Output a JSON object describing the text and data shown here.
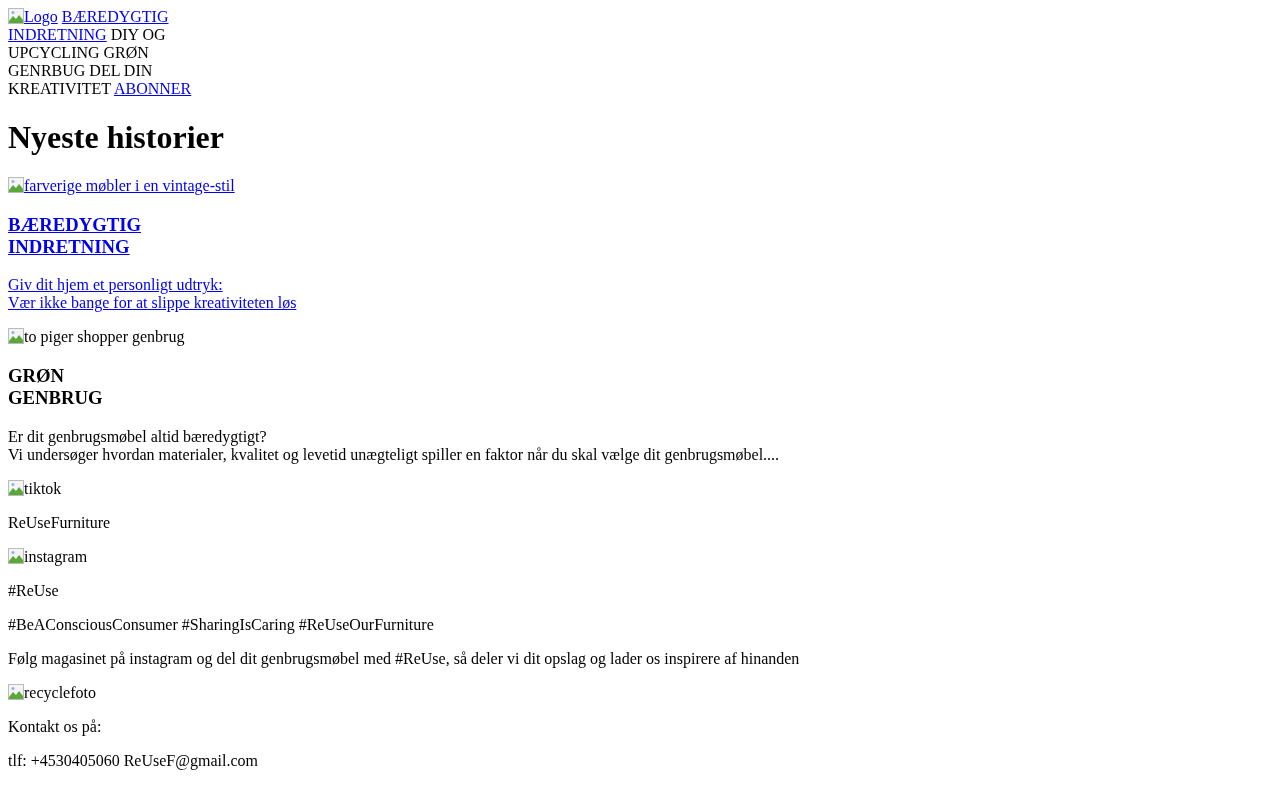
{
  "header": {
    "logo": {
      "alt": "Logo"
    },
    "items": [
      {
        "kind": "link",
        "lines": [
          "BÆREDYGTIG",
          "INDRETNING"
        ]
      },
      {
        "kind": "text",
        "lines": [
          "DIY OG",
          "UPCYCLING"
        ]
      },
      {
        "kind": "text",
        "lines": [
          "GRØN",
          "GENRBUG"
        ]
      },
      {
        "kind": "text",
        "lines": [
          "DEL DIN",
          "KREATIVITET"
        ]
      },
      {
        "kind": "link",
        "lines": [
          "ABONNER"
        ]
      }
    ]
  },
  "heading": "Nyeste historier",
  "articles": [
    {
      "image_alt": "farverige møbler i en vintage-stil",
      "linked": true,
      "title_lines": [
        "BÆREDYGTIG",
        "INDRETNING"
      ],
      "text_lines": [
        "Giv dit hjem et personligt udtryk:",
        "Vær ikke bange for at slippe kreativiteten løs"
      ]
    },
    {
      "image_alt": "to piger shopper genbrug",
      "linked": false,
      "title_lines": [
        "GRØN",
        "GENBRUG"
      ],
      "text_lines": [
        "Er dit genbrugsmøbel altid bæredygtigt?",
        "Vi undersøger hvordan materialer, kvalitet og levetid unægteligt spiller en faktor når du skal vælge dit genbrugsmøbel...."
      ]
    }
  ],
  "footer": [
    {
      "kind": "image",
      "alt": "tiktok"
    },
    {
      "kind": "text",
      "text": "ReUseFurniture"
    },
    {
      "kind": "image",
      "alt": "instagram"
    },
    {
      "kind": "text",
      "text": "#ReUse"
    },
    {
      "kind": "text",
      "text": "#BeAConsciousConsumer #SharingIsCaring #ReUseOurFurniture"
    },
    {
      "kind": "text",
      "text": "Følg magasinet på instagram og del dit genbrugsmøbel med #ReUse, så deler vi dit opslag og lader os inspirere af hinanden"
    },
    {
      "kind": "image",
      "alt": "recyclefoto"
    },
    {
      "kind": "text",
      "text": "Kontakt os på:"
    },
    {
      "kind": "text",
      "text": "tlf: +4530405060 ReUseF@gmail.com"
    }
  ]
}
